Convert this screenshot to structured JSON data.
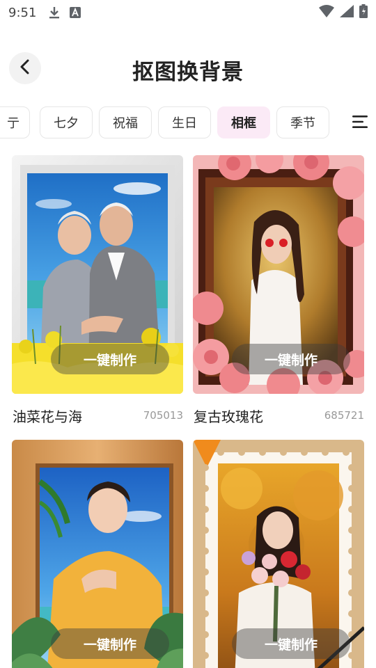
{
  "status_bar": {
    "time": "9:51"
  },
  "header": {
    "title": "抠图换背景"
  },
  "tabs": [
    {
      "label": "亍"
    },
    {
      "label": "七夕"
    },
    {
      "label": "祝福"
    },
    {
      "label": "生日"
    },
    {
      "label": "相框",
      "active": true
    },
    {
      "label": "季节"
    }
  ],
  "cards": [
    {
      "title": "油菜花与海",
      "count": "705013",
      "button": "一键制作"
    },
    {
      "title": "复古玫瑰花",
      "count": "685721",
      "button": "一键制作"
    },
    {
      "button": "一键制作"
    },
    {
      "button": "一键制作"
    }
  ],
  "colors": {
    "accent_tab_bg": "#fbeaf6"
  }
}
